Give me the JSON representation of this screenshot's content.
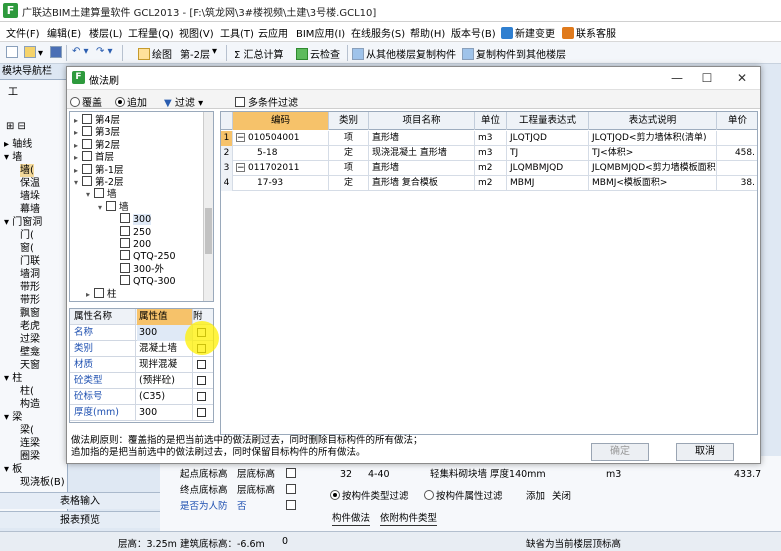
{
  "app": {
    "title": "广联达BIM土建算量软件 GCL2013 - [F:\\筑龙网\\3#楼视频\\土建\\3号楼.GCL10]"
  },
  "menu": {
    "items": [
      "文件(F)",
      "编辑(E)",
      "楼层(L)",
      "工程量(Q)",
      "视图(V)",
      "工具(T)",
      "云应用",
      "BIM应用(I)",
      "在线服务(S)",
      "帮助(H)",
      "版本号(B)",
      "新建变更",
      "联系客服"
    ]
  },
  "toolbar": {
    "draw_label": "绘图",
    "floor_value": "第-2层",
    "sum_label": "Σ 汇总计算",
    "cloud_check": "云检查",
    "copy_from": "从其他楼层复制构件",
    "copy_to": "复制构件到其他楼层"
  },
  "leftnav": {
    "title": "模块导航栏",
    "tab_partial": "工",
    "items": [
      "轴线",
      "墙",
      "墙(",
      "保温",
      "墙垛",
      "幕墙",
      "门窗洞",
      "门(",
      "窗(",
      "门联",
      "墙洞",
      "带形",
      "带形",
      "飘窗",
      "老虎",
      "过梁",
      "壁龛",
      "天窗",
      "柱",
      "柱(",
      "构造",
      "梁",
      "梁(",
      "连梁",
      "圈梁",
      "板",
      "现浇板(B)"
    ],
    "bottom_buttons": [
      "表格输入",
      "报表预览"
    ]
  },
  "dialog": {
    "title": "做法刷",
    "options": {
      "overwrite": "覆盖",
      "append": "追加",
      "filter": "过滤",
      "multi_filter": "多条件过滤"
    },
    "tree": [
      {
        "label": "第4层",
        "level": 1,
        "expander": "▸"
      },
      {
        "label": "第3层",
        "level": 1,
        "expander": "▸"
      },
      {
        "label": "第2层",
        "level": 1,
        "expander": "▸"
      },
      {
        "label": "首层",
        "level": 1,
        "expander": "▸"
      },
      {
        "label": "第-1层",
        "level": 1,
        "expander": "▸"
      },
      {
        "label": "第-2层",
        "level": 1,
        "expander": "▾"
      },
      {
        "label": "墙",
        "level": 2,
        "expander": "▾"
      },
      {
        "label": "墙",
        "level": 3,
        "expander": "▾"
      },
      {
        "label": "300",
        "level": 4,
        "expander": ""
      },
      {
        "label": "250",
        "level": 4,
        "expander": ""
      },
      {
        "label": "200",
        "level": 4,
        "expander": ""
      },
      {
        "label": "QTQ-250",
        "level": 4,
        "expander": ""
      },
      {
        "label": "300-外",
        "level": 4,
        "expander": ""
      },
      {
        "label": "QTQ-300",
        "level": 4,
        "expander": ""
      },
      {
        "label": "柱",
        "level": 2,
        "expander": "▸"
      }
    ],
    "props": {
      "header_name": "属性名称",
      "header_value": "属性值",
      "header_attach": "附",
      "rows": [
        {
          "name": "名称",
          "value": "300"
        },
        {
          "name": "类别",
          "value": "混凝土墙"
        },
        {
          "name": "材质",
          "value": "现拌混凝"
        },
        {
          "name": "砼类型",
          "value": "(预拌砼)"
        },
        {
          "name": "砼标号",
          "value": "(C35)"
        },
        {
          "name": "厚度(mm)",
          "value": "300"
        }
      ]
    },
    "grid": {
      "headers": [
        "编码",
        "类别",
        "项目名称",
        "单位",
        "工程量表达式",
        "表达式说明",
        "单价"
      ],
      "rows": [
        {
          "num": "1",
          "toggle": "−",
          "code": "010504001",
          "type": "项",
          "name": "直形墙",
          "unit": "m3",
          "expr": "JLQTJQD",
          "desc": "JLQTJQD<剪力墙体积(清单)",
          "price": ""
        },
        {
          "num": "2",
          "toggle": "",
          "code": "5-18",
          "type": "定",
          "name": "现浇混凝土 直形墙",
          "unit": "m3",
          "expr": "TJ",
          "desc": "TJ<体积>",
          "price": "458."
        },
        {
          "num": "3",
          "toggle": "−",
          "code": "011702011",
          "type": "项",
          "name": "直形墙",
          "unit": "m2",
          "expr": "JLQMBMJQD",
          "desc": "JLQMBMJQD<剪力墙模板面积",
          "price": ""
        },
        {
          "num": "4",
          "toggle": "",
          "code": "17-93",
          "type": "定",
          "name": "直形墙 复合模板",
          "unit": "m2",
          "expr": "MBMJ",
          "desc": "MBMJ<模板面积>",
          "price": "38."
        }
      ]
    },
    "description_lines": [
      "做法刷原则：覆盖指的是把当前选中的做法刷过去，同时删除目标构件的所有做法；",
      "追加指的是把当前选中的做法刷过去，同时保留目标构件的所有做法。"
    ],
    "ok_label": "确定",
    "cancel_label": "取消"
  },
  "lower": {
    "left_rows": [
      {
        "name": "起点底标高",
        "value": "层底标高"
      },
      {
        "name": "终点底标高",
        "value": "层底标高"
      },
      {
        "name": "是否为人防",
        "value": "否"
      }
    ],
    "table_row": {
      "num": "32",
      "code": "4-40",
      "name": "轻集料砌块墙 厚度140mm",
      "unit": "m3",
      "price": "433.7"
    },
    "filter_type": "按构件类型过滤",
    "filter_attr": "按构件属性过滤",
    "add": "添加",
    "close": "关闭",
    "tab_method": "构件做法",
    "tab_by_type": "依附构件类型"
  },
  "status": {
    "floor_height": "层高：3.25m",
    "base_elev": "建筑底标高：-6.6m",
    "zero": "0",
    "hint": "缺省为当前楼层顶标高"
  }
}
